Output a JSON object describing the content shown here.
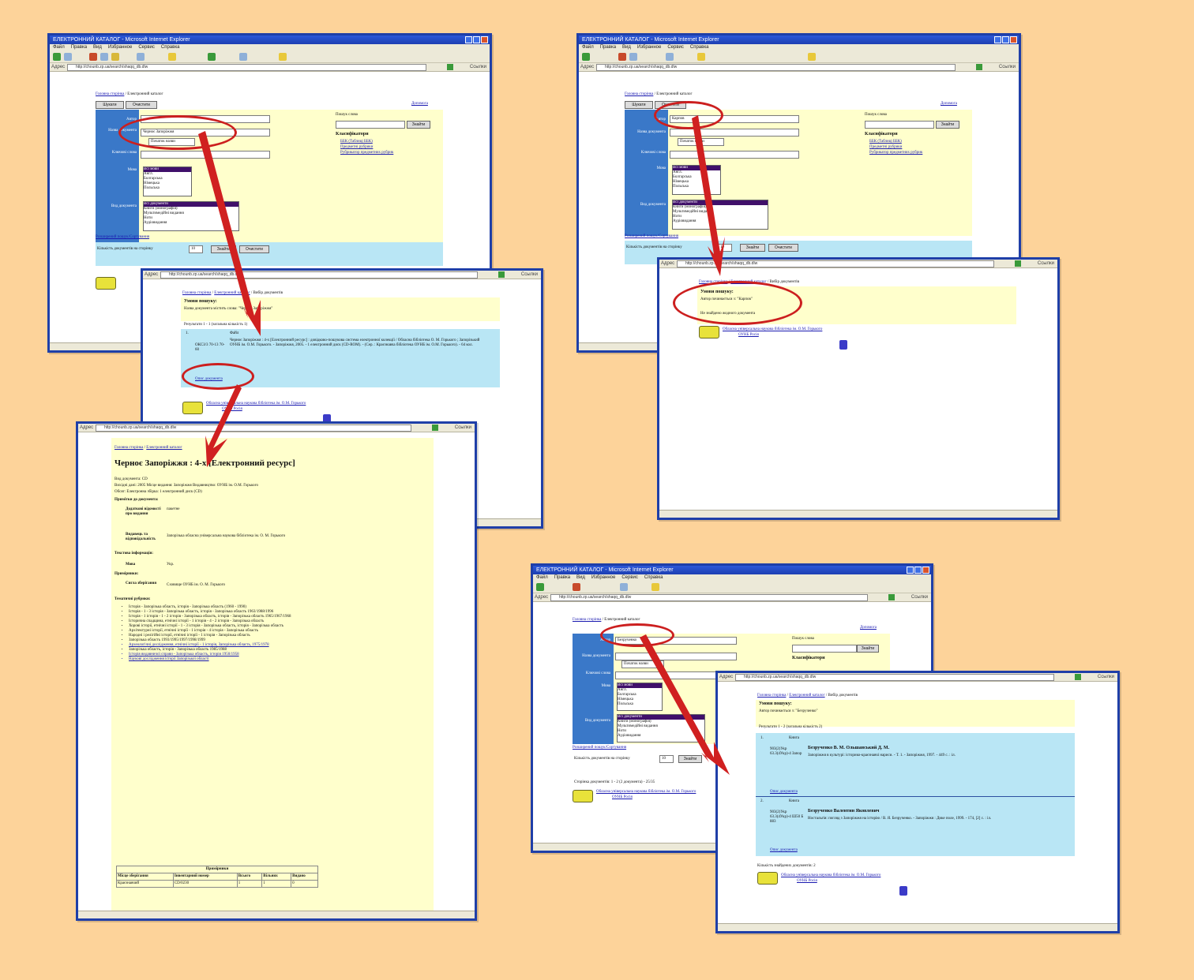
{
  "window_title": "ЕЛЕКТРОННИЙ КАТАЛОГ - Microsoft Internet Explorer",
  "menu": [
    "Файл",
    "Правка",
    "Вид",
    "Избранное",
    "Сервис",
    "Справка"
  ],
  "address_label": "Адрес",
  "address_url": "http://chounb.zp.ua/search/shaqq_db.dlw",
  "address_go": "Переход",
  "address_links": "Ссылки",
  "breadcrumb": [
    "Головна сторінка",
    "Електронний каталог",
    "Вибір документів"
  ],
  "search_form": {
    "tab_search": "Шукати",
    "tab_clear": "Очистити",
    "help_link": "Допомога",
    "field_author": "Автор",
    "field_title": "Назва документа",
    "field_title_value": "Черноє Запоріжжя",
    "field_keywords": "Ключові слова",
    "title_mode": "Початок назви",
    "field_lang": "Мова",
    "field_type": "Вид документа",
    "lang_options": [
      "Всі мови",
      "Англ.",
      "Болгарська",
      "Німецька",
      "Польська"
    ],
    "type_options": [
      "Всі документи",
      "Книги (монографія)",
      "Мультимедійні видання",
      "Ноти",
      "Аудіовидання"
    ],
    "right_search_label": "Пошук слова",
    "right_search_button": "Знайти",
    "classifiers_heading": "Класифікатори",
    "classifier_links": [
      "ББК (Таблиці ББК)",
      "Предметні рубрики",
      "Рубрикатор предметних рубрик"
    ],
    "extended_link": "Розширений пошук/Сортування",
    "per_page_label": "Кількість документів на сторінку",
    "per_page_value": "10",
    "submit": "Знайти",
    "reset": "Очистити"
  },
  "results_found": {
    "heading": "Умови пошуку:",
    "condition": "Назва документа містить слова: \"Черноє Запоріжжя\"",
    "count_line": "Результати 1 - 1 (загальна кількість 1)",
    "row_num": "1.",
    "row_type": "Файл",
    "row_code": "ОКСЗ/3 70-13 70-60",
    "row_text": "Черноє Запоріжжя : 4-х [Електронний ресурс] : довідково-пошукова система електронної колекції / Обласна бібліотека О. М. Горького ; Запорізький ОУНБ ім. О.М. Горького. - Запоріжжя, 2005. - 1 електронний диск (CD-ROM). - (Сер. : Краєзнавча бібліотека ОУНБ ім. О.М. Горького). - 64 кол.",
    "details_link": "Опис документа",
    "footer_link": "Обласна універсальна наукова бібліотека ім. О.М. Горького",
    "footer_link2": "ОУНБ Росія"
  },
  "detail_view": {
    "title": "Черноє Запоріжжя : 4-х [Електронний ресурс]",
    "meta_lines": [
      "Вид документа: CD",
      "Вихідні дані: 2005 Місце видання: Запоріжжя Видавництво: ОУНБ ім. О.М. Горького",
      "Обсяг: Електронна збірка: 1 електронний диск (CD)"
    ],
    "section_notes": "Примітки до документа:",
    "notes_rows": [
      {
        "label": "Додаткові відомості про видання",
        "value": "пакетне"
      },
      {
        "label": "Видавець та відповідальність",
        "value": "Запорізька обласна універсальна наукова бібліотека ім. О. М. Горького"
      }
    ],
    "section_fulltext": "Текстова інформація:",
    "lang_label": "Мова",
    "lang_value": "Укр.",
    "section_holding": "Примірники:",
    "holding_label": "Сигла зберігання",
    "holding_value": "Сховище ОУНБ ім. О. М. Горького",
    "section_subjects": "Тематичні рубрики:",
    "subjects": [
      "Історія - Запорізька область, історія - Запорізька область (1960 - 1990)",
      "Історія - 1 - 3 історія - Запорізька область, історія - Запорізька область 1963/1988/1996",
      "Історія - 1 історія - 1 - 2 історія - Запорізька область, історія - Запорізька область 1965/1967/1968",
      "Історична спадщина, етнічні історії - 1 історія - 4 - 2 історія - Запорізька область",
      "Хорові історії, етнічні історії - 1 - 3 історія - Запорізька область, історія - Запорізька область",
      "Архітектурні історії, етнічні історії - 1 історія - 4 історія - Запорізька область",
      "Народні і релігійні історії, етнічні історії - 1 історія - Запорізька область",
      "Запорізька область 1993/1995/1997/1998/1999",
      "Археологічні дослідження, етнічні історії - 1 історія, Запорізька область, 1975/1978",
      "Запорізька область, історія - Запорізька область 1985/1988",
      "Історія видавничої справи - Запорізька область, історія 1950/1958",
      "Наукові дослідження історії Запорізької області"
    ],
    "table_caption": "Примірники",
    "table_headers": [
      "Місце зберігання",
      "Інвентарний номер",
      "Всього",
      "Вільних",
      "Видано"
    ],
    "table_row": [
      "Краєзнавчий",
      "CD/0230",
      "1",
      "1",
      "0"
    ]
  },
  "results_empty": {
    "heading": "Умови пошуку:",
    "condition": "Автор починається з: \"Карпов\"",
    "message": "Не знайдено жодного документа",
    "field_author_value": "Карпов"
  },
  "results_two": {
    "heading": "Умови пошуку:",
    "condition": "Автор починається з: \"Безрученко\"",
    "field_author_value": "Безрученко",
    "count_line": "Результати 1 - 2 (загальна кількість 2)",
    "items": [
      {
        "num": "1.",
        "type": "Книга",
        "code": "903(2)Укр 63.3(4Укр)-4 Запор",
        "author": "Безрученко В. М. Ольшанський Д. М.",
        "text": "Запоріжжя в культурі: історико-краєзнавчі нариси. - Т. 1. - Запоріжжя, 1997. - 449 с. : іл.",
        "link": "Опис документа"
      },
      {
        "num": "2.",
        "type": "Книга",
        "code": "903(2)Укр 63.3(4Укр)-4 Ш50 Б 883",
        "author": "Безрученко Валентин Яковлевич",
        "text": "Ностальгія: погляд з Запоріжжя на історію / В. Я. Безрученко. - Запоріжжя : Дике поле, 1999. - 174, [2] с. : іл.",
        "link": "Опис документа"
      }
    ],
    "count_footer": "Кількість знайдених документів: 2",
    "total_line": "Сторінка документів: 1 - 2 (2 документа) - 25/35"
  },
  "colors": {
    "background": "#fdd39a",
    "annotation": "#cc1f1f",
    "panel_yellow": "#ffffcc",
    "panel_cyan": "#b9e6f5",
    "form_blue": "#3a78c8"
  }
}
